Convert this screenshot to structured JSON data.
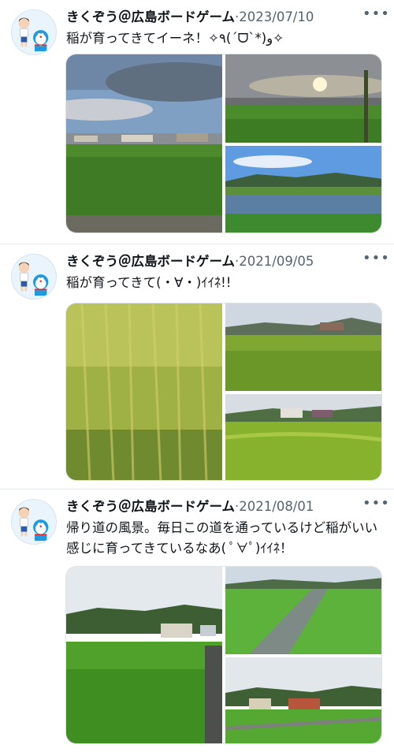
{
  "tweets": [
    {
      "author_name": "きくぞう＠広島ボードゲーム",
      "separator": "·",
      "date": "2023/07/10",
      "text": "稲が育ってきてイーネ！✧٩(ˊᗜˋ*)و✧",
      "more_label": "•••",
      "photos": [
        "rice-field-cloudy-sky",
        "rice-field-sunset",
        "flooded-paddy-mountains"
      ]
    },
    {
      "author_name": "きくぞう＠広島ボードゲーム",
      "separator": "·",
      "date": "2021/09/05",
      "text": "稲が育ってきて(・∀・)ｲｲﾈ!!",
      "more_label": "•••",
      "photos": [
        "ripening-rice-closeup",
        "rice-field-houses",
        "rice-terraces-village"
      ]
    },
    {
      "author_name": "きくぞう＠広島ボードゲーム",
      "separator": "·",
      "date": "2021/08/01",
      "text": "帰り道の風景。毎日この道を通っているけど稲がいい感じに育ってきているなあ( ﾟ∀ﾟ)ｲｲﾈ！",
      "more_label": "•••",
      "photos": [
        "green-rice-field-houses",
        "paddy-road-rows",
        "paddy-farmhouse-hills"
      ]
    }
  ],
  "icons": {
    "avatar": "doraemon-and-boy-avatar-icon",
    "more": "more-options-icon"
  },
  "colors": {
    "text_primary": "#0f1419",
    "text_secondary": "#536471",
    "divider": "#e6e9ec",
    "rice_green": "#4f9a2e",
    "sky_blue": "#8fb8df"
  }
}
